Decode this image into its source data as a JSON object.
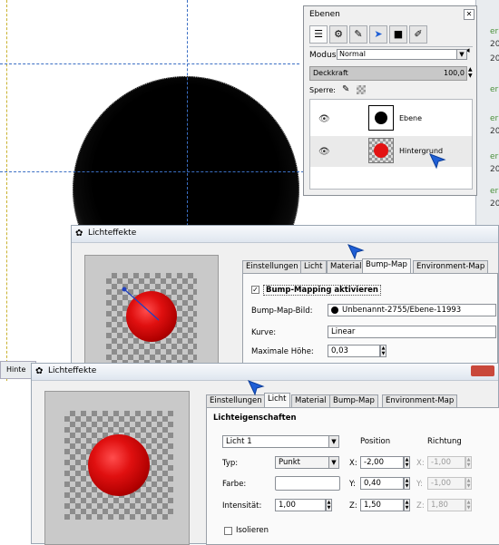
{
  "right_strip": [
    "er",
    "20",
    "20",
    "er",
    "er",
    "20",
    "er",
    "20",
    "er",
    "20"
  ],
  "layers_panel": {
    "title": "Ebenen",
    "close_icon": "close-icon",
    "tab_icons": [
      "layers-icon",
      "channels-icon",
      "paths-icon",
      "pointer-icon",
      "colors-icon",
      "brush-icon"
    ],
    "modus_label": "Modus:",
    "modus_value": "Normal",
    "deckkraft_label": "Deckkraft",
    "deckkraft_value": "100,0",
    "sperre_label": "Sperre:",
    "layers": [
      {
        "name": "Ebene",
        "visible": true
      },
      {
        "name": "Hintergrund",
        "visible": true
      }
    ]
  },
  "dialog_back": {
    "title": "Lichteffekte",
    "tabs": [
      "Einstellungen",
      "Licht",
      "Material",
      "Bump-Map",
      "Environment-Map"
    ],
    "active_tab": "Bump-Map",
    "enable_label": "Bump-Mapping aktivieren",
    "enable_checked": "✓",
    "bump_map_label": "Bump-Map-Bild:",
    "bump_map_value": "Unbenannt-2755/Ebene-11993",
    "curve_label": "Kurve:",
    "curve_value": "Linear",
    "max_height_label": "Maximale Höhe:",
    "max_height_value": "0,03"
  },
  "hint_fragment": "Hinte",
  "dialog_front": {
    "title": "Lichteffekte",
    "tabs": [
      "Einstellungen",
      "Licht",
      "Material",
      "Bump-Map",
      "Environment-Map"
    ],
    "active_tab": "Licht",
    "section_label": "Lichteigenschaften",
    "light_select": "Licht 1",
    "position_header": "Position",
    "direction_header": "Richtung",
    "type_label": "Typ:",
    "type_value": "Punkt",
    "color_label": "Farbe:",
    "intensity_label": "Intensität:",
    "intensity_value": "1,00",
    "isolate_label": "Isolieren",
    "position": {
      "x_label": "X:",
      "x": "-2,00",
      "y_label": "Y:",
      "y": "0,40",
      "z_label": "Z:",
      "z": "1,50"
    },
    "direction": {
      "x_label": "X:",
      "x": "-1,00",
      "y_label": "Y:",
      "y": "-1,00",
      "z_label": "Z:",
      "z": "1,80"
    }
  },
  "colors": {
    "accent_blue": "#1f5fd6",
    "ball_red": "#e01010"
  }
}
